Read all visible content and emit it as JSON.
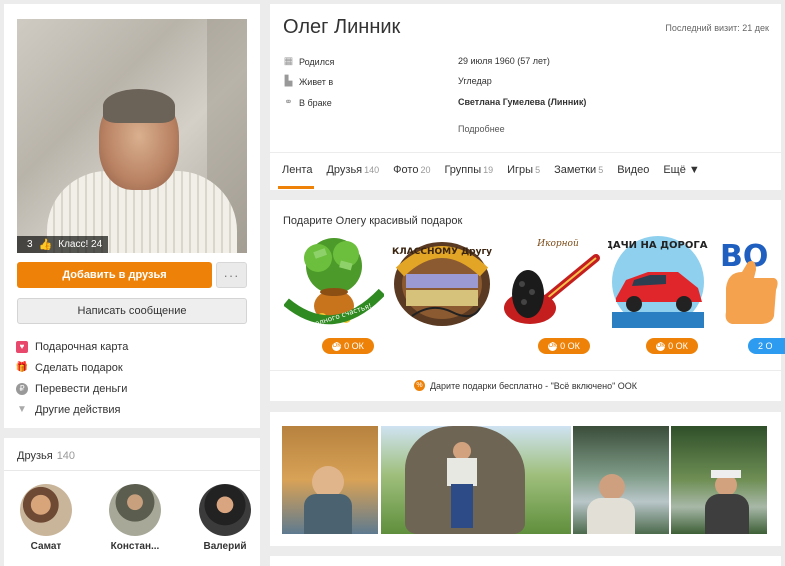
{
  "profile": {
    "name": "Олег Линник",
    "last_visit": "Последний визит: 21 дек",
    "photo_stats": {
      "count": "3",
      "likes": "Класс! 24"
    },
    "info": [
      {
        "label": "Родился",
        "value": "29 июля 1960 (57 лет)",
        "icon": "calendar-icon"
      },
      {
        "label": "Живет в",
        "value": "Угледар",
        "icon": "building-icon"
      },
      {
        "label": "В браке",
        "value": "Светлана Гумелева (Линник)",
        "icon": "rings-icon"
      }
    ],
    "more_link": "Подробнее"
  },
  "buttons": {
    "add_friend": "Добавить в друзья",
    "more": "···",
    "message": "Написать сообщение"
  },
  "actions": [
    {
      "label": "Подарочная карта",
      "icon": "gift-card-icon"
    },
    {
      "label": "Сделать подарок",
      "icon": "gift-icon"
    },
    {
      "label": "Перевести деньги",
      "icon": "ruble-coin-icon"
    },
    {
      "label": "Другие действия",
      "icon": "chevron-down-icon"
    }
  ],
  "tabs": [
    {
      "label": "Лента",
      "count": ""
    },
    {
      "label": "Друзья",
      "count": "140"
    },
    {
      "label": "Фото",
      "count": "20"
    },
    {
      "label": "Группы",
      "count": "19"
    },
    {
      "label": "Игры",
      "count": "5"
    },
    {
      "label": "Заметки",
      "count": "5"
    },
    {
      "label": "Видео",
      "count": ""
    },
    {
      "label": "Ещё ▼",
      "count": ""
    }
  ],
  "gifts": {
    "title": "Подарите Олегу красивый подарок",
    "items": [
      {
        "caption": "Для полного счастья!",
        "price": "0 ОК"
      },
      {
        "caption": "КЛАССНОМУ Другу",
        "price": ""
      },
      {
        "caption": "Икорной",
        "price": "0 ОК"
      },
      {
        "caption": "УДАЧИ НА ДОРОГАХ!",
        "price": "0 ОК"
      },
      {
        "caption": "ВО",
        "price": "2 О"
      }
    ],
    "promo": "Дарите подарки бесплатно - \"Всё включено\" ООК"
  },
  "friends": {
    "title": "Друзья",
    "count": "140",
    "items": [
      {
        "name": "Самат"
      },
      {
        "name": "Констан..."
      },
      {
        "name": "Валерий"
      }
    ]
  },
  "colors": {
    "accent": "#ee8208",
    "blue": "#2d9bf0",
    "page_bg": "#ececec"
  }
}
